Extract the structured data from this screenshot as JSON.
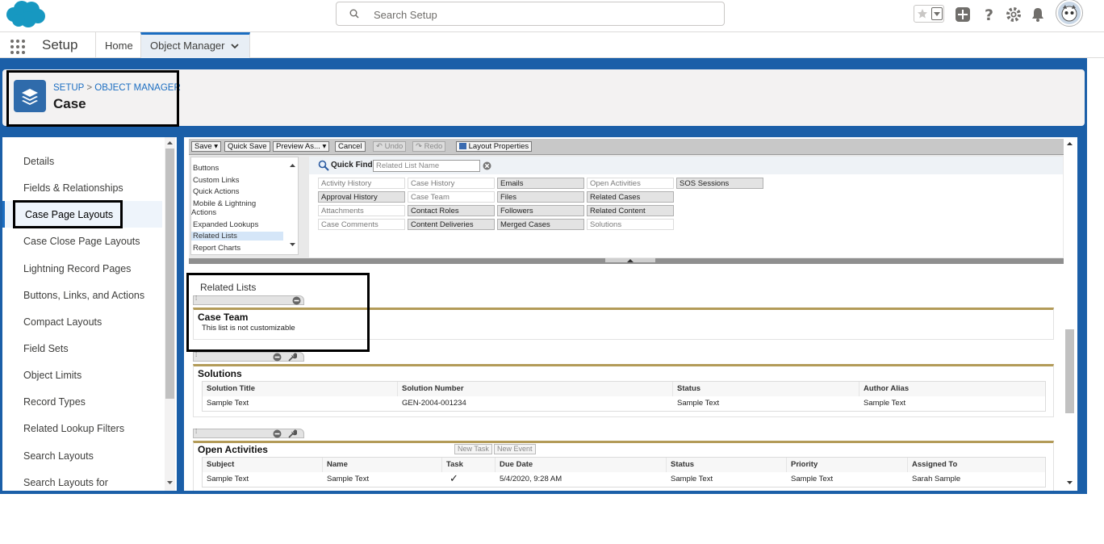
{
  "header": {
    "search_placeholder": "Search Setup"
  },
  "nav": {
    "app_name": "Setup",
    "tabs": [
      {
        "label": "Home"
      },
      {
        "label": "Object Manager"
      }
    ]
  },
  "page_header": {
    "breadcrumb_setup": "SETUP",
    "breadcrumb_sep": ">",
    "breadcrumb_om": "OBJECT MANAGER",
    "title": "Case"
  },
  "sidebar": {
    "items": [
      {
        "label": "Details"
      },
      {
        "label": "Fields & Relationships"
      },
      {
        "label": "Case Page Layouts"
      },
      {
        "label": "Case Close Page Layouts"
      },
      {
        "label": "Lightning Record Pages"
      },
      {
        "label": "Buttons, Links, and Actions"
      },
      {
        "label": "Compact Layouts"
      },
      {
        "label": "Field Sets"
      },
      {
        "label": "Object Limits"
      },
      {
        "label": "Record Types"
      },
      {
        "label": "Related Lookup Filters"
      },
      {
        "label": "Search Layouts"
      },
      {
        "label": "Search Layouts for"
      }
    ]
  },
  "toolbar": {
    "save": "Save",
    "quick_save": "Quick Save",
    "preview_as": "Preview As...",
    "cancel": "Cancel",
    "undo": "Undo",
    "redo": "Redo",
    "layout_properties": "Layout Properties"
  },
  "palette": {
    "categories": [
      "Buttons",
      "Custom Links",
      "Quick Actions",
      "Mobile & Lightning",
      "Actions",
      "Expanded Lookups",
      "Related Lists",
      "Report Charts"
    ],
    "quick_find_label": "Quick Find",
    "quick_find_placeholder": "Related List Name",
    "items": [
      {
        "label": "Activity History",
        "used": true
      },
      {
        "label": "Case History",
        "used": true
      },
      {
        "label": "Emails",
        "used": false
      },
      {
        "label": "Open Activities",
        "used": true
      },
      {
        "label": "SOS Sessions",
        "used": false
      },
      {
        "label": "Approval History",
        "used": false
      },
      {
        "label": "Case Team",
        "used": true
      },
      {
        "label": "Files",
        "used": false
      },
      {
        "label": "Related Cases",
        "used": false
      },
      {
        "label": "Attachments",
        "used": true
      },
      {
        "label": "Contact Roles",
        "used": false
      },
      {
        "label": "Followers",
        "used": false
      },
      {
        "label": "Related Content",
        "used": false
      },
      {
        "label": "Case Comments",
        "used": true
      },
      {
        "label": "Content Deliveries",
        "used": false
      },
      {
        "label": "Merged Cases",
        "used": false
      },
      {
        "label": "Solutions",
        "used": true
      }
    ]
  },
  "canvas": {
    "section_title": "Related Lists",
    "case_team": {
      "title": "Case Team",
      "note": "This list is not customizable"
    },
    "solutions": {
      "title": "Solutions",
      "columns": [
        "Solution Title",
        "Solution Number",
        "Status",
        "Author Alias"
      ],
      "row": [
        "Sample Text",
        "GEN-2004-001234",
        "Sample Text",
        "Sample Text"
      ]
    },
    "open_activities": {
      "title": "Open Activities",
      "new_task": "New Task",
      "new_event": "New Event",
      "columns": [
        "Subject",
        "Name",
        "Task",
        "Due Date",
        "Status",
        "Priority",
        "Assigned To"
      ],
      "row": [
        "Sample Text",
        "Sample Text",
        "✓",
        "5/4/2020, 9:28 AM",
        "Sample Text",
        "Sample Text",
        "Sarah Sample"
      ]
    }
  }
}
